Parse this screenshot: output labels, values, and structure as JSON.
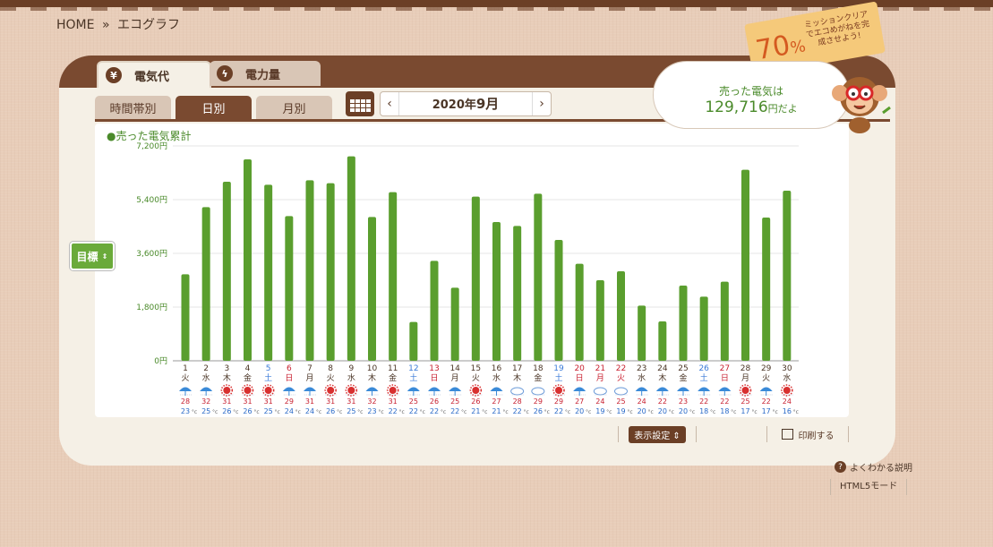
{
  "breadcrumb": {
    "home": "HOME",
    "sep": "»",
    "current": "エコグラフ"
  },
  "tabs": [
    {
      "label": "電気代",
      "icon": "yen-icon"
    },
    {
      "label": "電力量",
      "icon": "lightning-icon"
    }
  ],
  "subtabs": [
    "時間帯別",
    "日別",
    "月別"
  ],
  "month": {
    "prefix": "2020年",
    "month": "9月",
    "prev": "‹",
    "next": "›"
  },
  "legend": "●売った電気累計",
  "speech": {
    "line1": "売った電気は",
    "amount": "129,716",
    "unit": "円だよ"
  },
  "mission": {
    "percent": "70",
    "percent_sign": "%",
    "text": "ミッションクリアでエコめがねを完成させよう!"
  },
  "goal_button": "目標",
  "display_settings": "表示設定",
  "print": "印刷する",
  "help": "よくわかる説明",
  "html5": "HTML5モード",
  "colors": {
    "bar": "#5a9e2e",
    "sat": "#3a7ad8",
    "sun": "#c82030",
    "brown": "#6b3f26"
  },
  "chart_data": {
    "type": "bar",
    "ylim": [
      0,
      7200
    ],
    "yticks": [
      "0円",
      "1,800円",
      "3,600円",
      "5,400円",
      "7,200円"
    ],
    "categories": [
      "1",
      "2",
      "3",
      "4",
      "5",
      "6",
      "7",
      "8",
      "9",
      "10",
      "11",
      "12",
      "13",
      "14",
      "15",
      "16",
      "17",
      "18",
      "19",
      "20",
      "21",
      "22",
      "23",
      "24",
      "25",
      "26",
      "27",
      "28",
      "29",
      "30"
    ],
    "weekdays": [
      "火",
      "水",
      "木",
      "金",
      "土",
      "日",
      "月",
      "火",
      "水",
      "木",
      "金",
      "土",
      "日",
      "月",
      "火",
      "水",
      "木",
      "金",
      "土",
      "日",
      "月",
      "火",
      "水",
      "木",
      "金",
      "土",
      "日",
      "月",
      "火",
      "水"
    ],
    "day_types": [
      "w",
      "w",
      "w",
      "w",
      "sat",
      "sun",
      "w",
      "w",
      "w",
      "w",
      "w",
      "sat",
      "sun",
      "w",
      "w",
      "w",
      "w",
      "w",
      "sat",
      "sun",
      "sun",
      "sun",
      "w",
      "w",
      "w",
      "sat",
      "sun",
      "w",
      "w",
      "w"
    ],
    "values": [
      2900,
      5150,
      6000,
      6750,
      5900,
      4850,
      6050,
      5950,
      6850,
      4820,
      5650,
      1300,
      3350,
      2450,
      5500,
      4650,
      4520,
      5600,
      4050,
      3250,
      2700,
      3000,
      1850,
      1320,
      2520,
      2150,
      2650,
      6400,
      4800,
      5700
    ],
    "weather": [
      "rain",
      "rain",
      "sun",
      "sun",
      "sun",
      "rain",
      "rain",
      "sun",
      "sun",
      "rain",
      "sun",
      "rain",
      "rain",
      "rain",
      "sun",
      "rain",
      "cloud",
      "cloud",
      "sun",
      "rain",
      "cloud",
      "cloud",
      "rain",
      "rain",
      "rain",
      "rain",
      "rain",
      "sun",
      "rain",
      "sun"
    ],
    "temp_high": [
      28,
      32,
      31,
      31,
      31,
      29,
      31,
      31,
      31,
      32,
      31,
      25,
      26,
      25,
      26,
      27,
      28,
      29,
      29,
      27,
      24,
      25,
      24,
      22,
      23,
      22,
      22,
      25,
      22,
      24
    ],
    "temp_low": [
      23,
      25,
      26,
      26,
      25,
      24,
      24,
      26,
      25,
      23,
      22,
      22,
      22,
      22,
      21,
      21,
      22,
      26,
      22,
      20,
      19,
      19,
      20,
      20,
      20,
      18,
      18,
      17,
      17,
      16
    ]
  }
}
